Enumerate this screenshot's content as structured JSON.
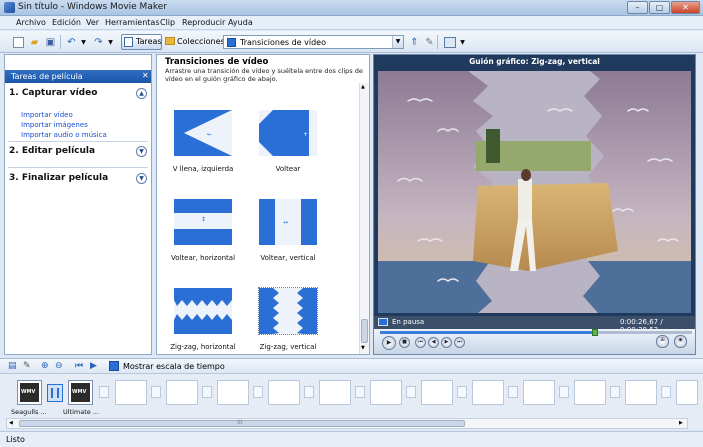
{
  "window": {
    "title": "Sin título - Windows Movie Maker"
  },
  "menu": [
    "Archivo",
    "Edición",
    "Ver",
    "Herramientas",
    "Clip",
    "Reproducir",
    "Ayuda"
  ],
  "toolbar": {
    "tasks_label": "Tareas",
    "collections_label": "Colecciones",
    "collection_value": "Transiciones de vídeo"
  },
  "tasks": {
    "header": "Tareas de película",
    "sections": [
      "1. Capturar vídeo",
      "2. Editar película",
      "3. Finalizar película"
    ],
    "capture_links": [
      "Importar vídeo",
      "Importar imágenes",
      "Importar audio o música"
    ]
  },
  "collection": {
    "title": "Transiciones de vídeo",
    "description": "Arrastre una transición de vídeo y suéltela entre dos clips de vídeo en el guión gráfico de abajo.",
    "items": [
      "V llena, izquierda",
      "Voltear",
      "Voltear, horizontal",
      "Voltear, vertical",
      "Zig-zag, horizontal",
      "Zig-zag, vertical"
    ]
  },
  "preview": {
    "title": "Guión gráfico: Zig-zag, vertical",
    "status": "En pausa",
    "time": "0:00:26,67 / 0:00:38,53",
    "progress": 0.69
  },
  "timeline": {
    "show_timeline_label": "Mostrar escala de tiempo"
  },
  "storyboard": {
    "clips": [
      {
        "label": "Seagulls ...",
        "badge": "WMV"
      },
      {
        "label": "Ultimate ...",
        "badge": "WMV"
      }
    ]
  },
  "status": "Listo",
  "colors": {
    "accent": "#1b55a6",
    "transition_blue": "#2a6fd6"
  }
}
